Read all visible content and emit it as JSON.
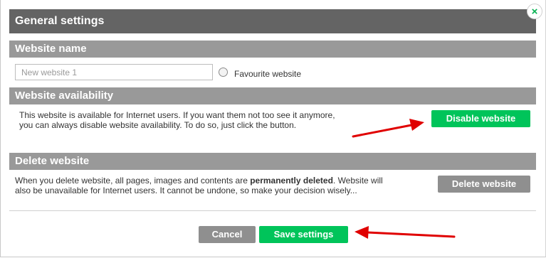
{
  "dialog": {
    "title": "General settings",
    "close_symbol": "×"
  },
  "website_name": {
    "heading": "Website name",
    "input_placeholder": "New website 1",
    "favourite_label": "Favourite website"
  },
  "availability": {
    "heading": "Website availability",
    "description_line1": "This website is available for Internet users. If you want them not too see it anymore,",
    "description_line2": "you can always disable website availability. To do so, just click the button.",
    "disable_button": "Disable website"
  },
  "delete": {
    "heading": "Delete website",
    "line1_before": "When you delete website, all pages, images and contents are ",
    "line1_bold": "permanently deleted",
    "line1_after": ". Website will",
    "line2": "also be unavailable for Internet users. It cannot be undone, so make your decision wisely...",
    "delete_button": "Delete website"
  },
  "footer": {
    "cancel_button": "Cancel",
    "save_button": "Save settings"
  },
  "colors": {
    "title_bar": "#646464",
    "section_header": "#999999",
    "primary_button": "#00c45a",
    "secondary_button": "#8f8f8f",
    "annotation_arrow": "#e00000"
  }
}
